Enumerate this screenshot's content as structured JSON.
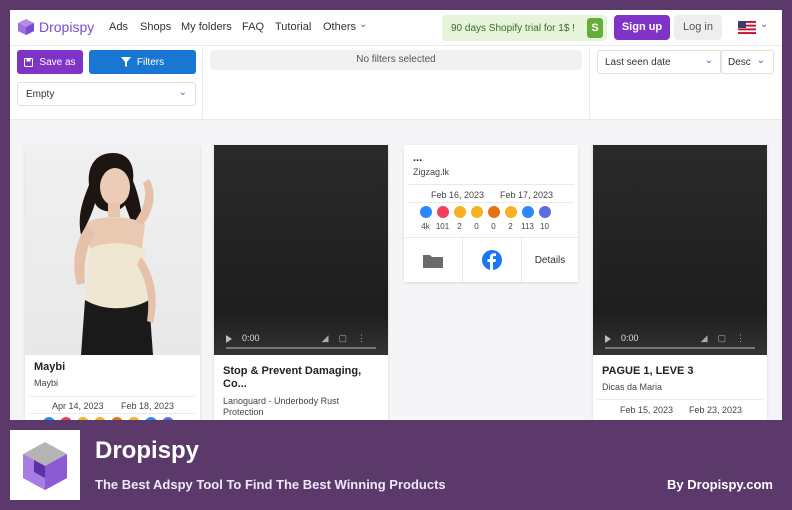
{
  "nav": {
    "logo": "Dropispy",
    "items": [
      "Ads",
      "Shops",
      "My folders",
      "FAQ",
      "Tutorial",
      "Others"
    ],
    "promo": "90 days Shopify trial for 1$ !",
    "signup": "Sign up",
    "login": "Log in"
  },
  "filters": {
    "save_label": "Save as",
    "filters_label": "Filters",
    "empty_select": "Empty",
    "no_filters": "No filters selected",
    "sort_by": "Last seen date",
    "sort_dir": "Desc"
  },
  "cards": [
    {
      "title": "Maybi",
      "subtitle": "Maybi",
      "date_start": "Apr 14, 2023",
      "date_end": "Feb 18, 2023"
    },
    {
      "title": "Stop & Prevent Damaging, Co...",
      "subtitle": "Lanoguard - Underbody Rust Protection",
      "video_time": "0:00"
    },
    {
      "title": "...",
      "subtitle": "Zigzag.lk",
      "date_start": "Feb 16, 2023",
      "date_end": "Feb 17, 2023",
      "reactions": [
        {
          "icon": "like-icon",
          "color": "#2d88ff",
          "count": "4k"
        },
        {
          "icon": "love-icon",
          "color": "#f33e58",
          "count": "101"
        },
        {
          "icon": "haha-icon",
          "color": "#f7b125",
          "count": "2"
        },
        {
          "icon": "care-icon",
          "color": "#f7b125",
          "count": "0"
        },
        {
          "icon": "angry-icon",
          "color": "#e9710f",
          "count": "0"
        },
        {
          "icon": "wow-icon",
          "color": "#f7b125",
          "count": "2"
        },
        {
          "icon": "share-icon",
          "color": "#2d88ff",
          "count": "113"
        },
        {
          "icon": "comment-icon",
          "color": "#5b6ee1",
          "count": "10"
        }
      ],
      "details": "Details"
    },
    {
      "title": "PAGUE 1, LEVE 3",
      "subtitle": "Dicas da Maria",
      "date_start": "Feb 15, 2023",
      "date_end": "Feb 23, 2023",
      "video_time": "0:00"
    }
  ],
  "footer": {
    "title": "Dropispy",
    "subtitle": "The Best Adspy Tool To Find The Best Winning Products",
    "byline": "By Dropispy.com"
  },
  "colors": {
    "brand": "#8034c7",
    "filter_blue": "#1976d2",
    "banner": "#5b3a6b",
    "promo_green": "#68ad3b"
  }
}
